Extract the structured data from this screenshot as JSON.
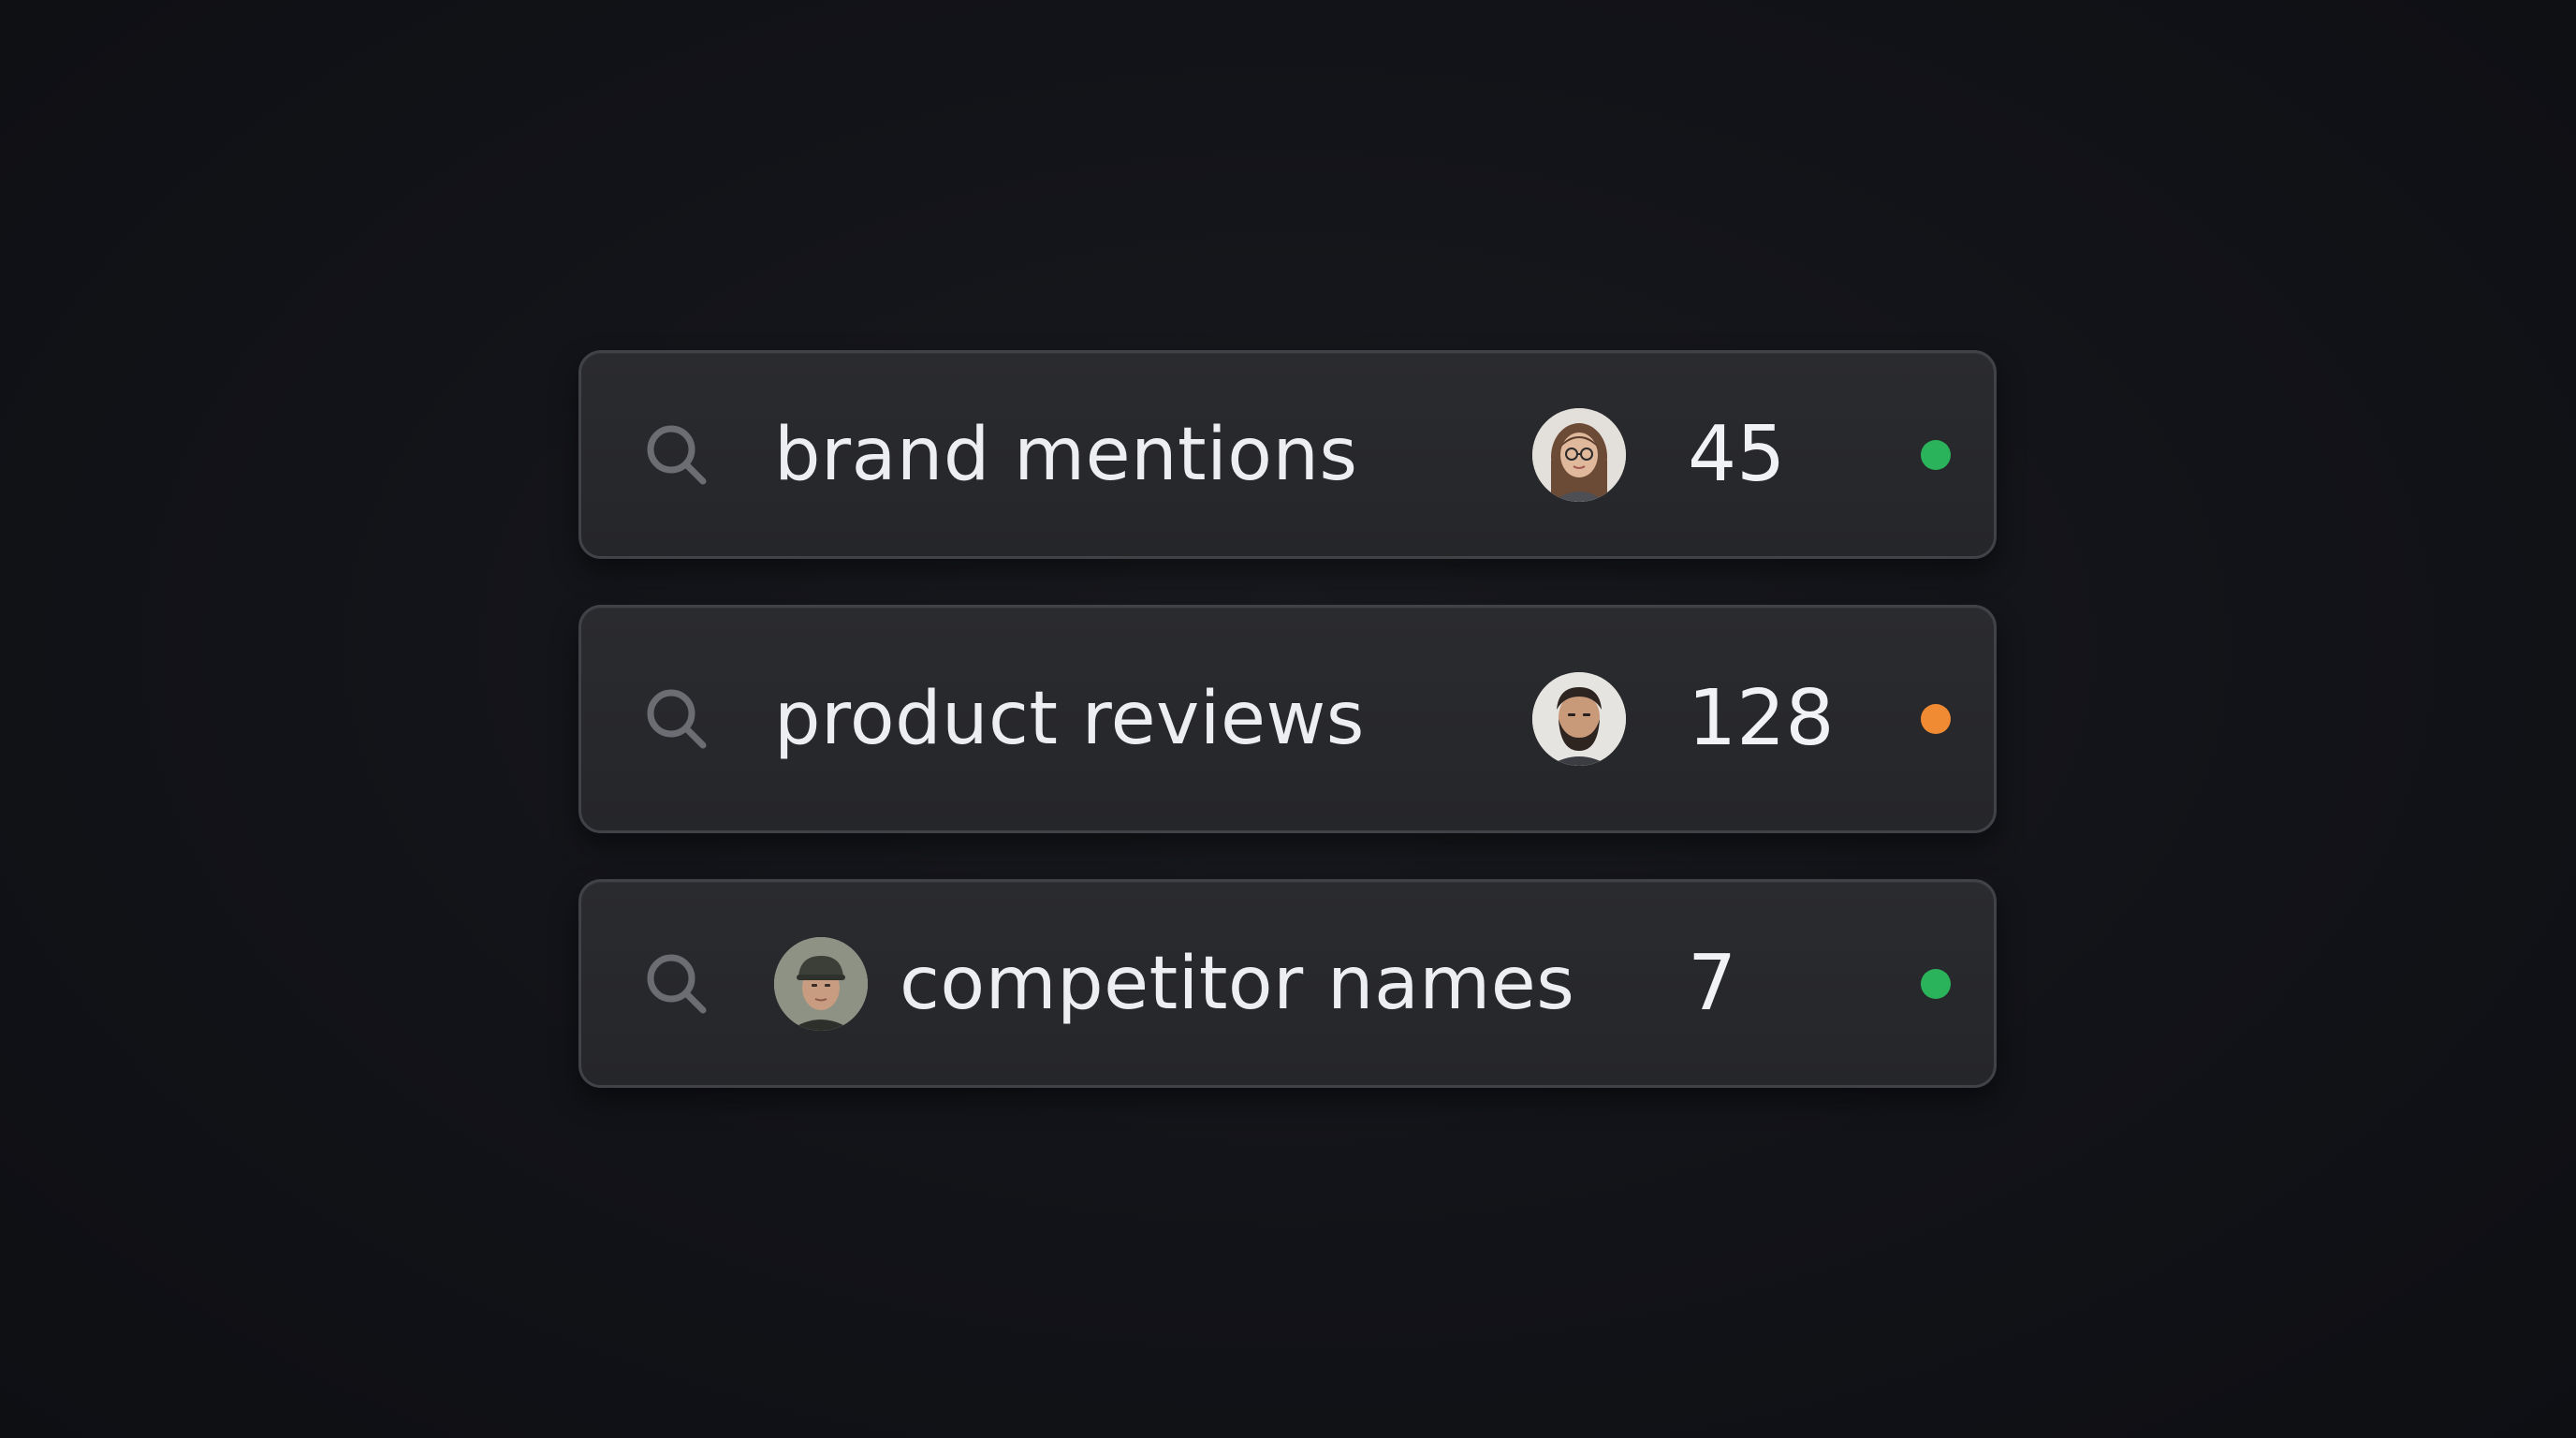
{
  "rows": [
    {
      "term": "brand mentions",
      "count": "45",
      "avatar": "woman-with-glasses-avatar",
      "status_color": "#2bb35c",
      "status": "green"
    },
    {
      "term": "product reviews",
      "count": "128",
      "avatar": "bearded-man-avatar",
      "status_color": "#f08b33",
      "status": "orange"
    },
    {
      "term": "competitor names",
      "count": "7",
      "avatar": "man-in-cap-avatar",
      "status_color": "#2bb35c",
      "status": "green"
    }
  ],
  "icons": {
    "search": "search-icon"
  }
}
